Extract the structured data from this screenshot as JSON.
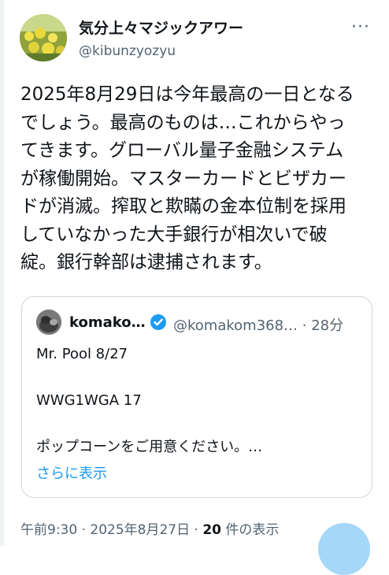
{
  "author": {
    "display_name": "気分上々マジックアワー",
    "handle": "@kibunzyozyu"
  },
  "more_label": "···",
  "tweet_text": "2025年8月29日は今年最高の一日となる\nでしょう。最高のものは…これからやっ\nてきます。グローバル量子金融システム\nが稼働開始。マスターカードとビザカー\nドが消滅。搾取と欺瞞の金本位制を採用\nしていなかった大手銀行が相次いで破\n綻。銀行幹部は逮捕されます。",
  "quote": {
    "name": "komako…",
    "handle_time": "@komakom368… · 28分",
    "text": "Mr. Pool   8/27\n\nWWG1WGA 17\n\nポップコーンをご用意ください。…",
    "show_more": "さらに表示"
  },
  "meta": {
    "time_date": "午前9:30 · 2025年8月27日 · ",
    "views_count": "20",
    "views_label": " 件の表示"
  },
  "colors": {
    "accent": "#1d9bf0",
    "secondary_text": "#536471",
    "border": "#cfd9de"
  },
  "icons": {
    "verified": "verified-badge-icon",
    "more": "more-options-icon"
  }
}
